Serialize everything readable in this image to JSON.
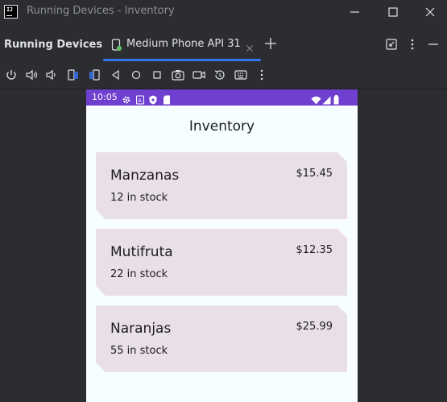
{
  "window": {
    "title": "Running Devices - Inventory",
    "logo_text": "IJ"
  },
  "tool_window": {
    "title": "Running Devices",
    "device_tab": {
      "label": "Medium Phone API 31"
    }
  },
  "toolbar": {
    "buttons": [
      "power",
      "volume-up",
      "volume-down",
      "rotate-left",
      "rotate-right",
      "back",
      "home",
      "overview",
      "screenshot",
      "screen-record",
      "reset",
      "keyboard",
      "more"
    ]
  },
  "emulator": {
    "status_bar": {
      "time": "10:05",
      "color": "#6f3fd0"
    },
    "app_title": "Inventory",
    "items": [
      {
        "name": "Manzanas",
        "price": "$15.45",
        "stock": "12 in stock"
      },
      {
        "name": "Mutifruta",
        "price": "$12.35",
        "stock": "22 in stock"
      },
      {
        "name": "Naranjas",
        "price": "$25.99",
        "stock": "55 in stock"
      }
    ]
  },
  "colors": {
    "ide_background": "#2b2d30",
    "accent": "#3574f0",
    "card_background": "#e8dfe8",
    "app_background": "#f6feff"
  }
}
